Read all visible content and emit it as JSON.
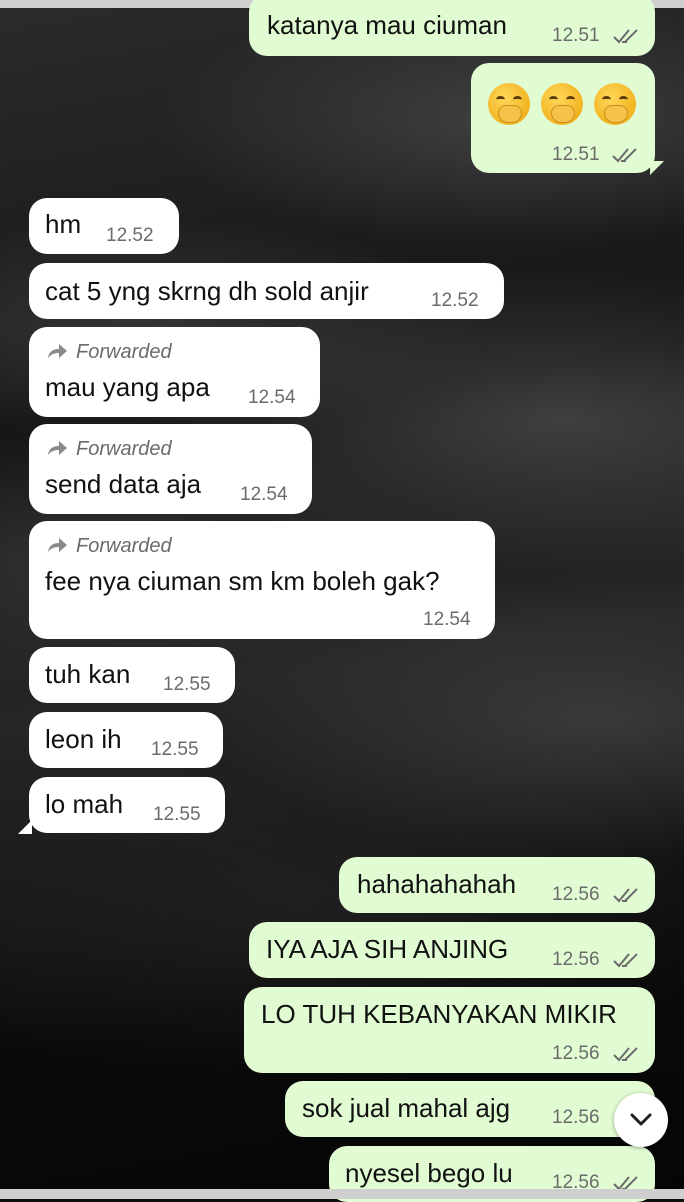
{
  "forwarded_label": "Forwarded",
  "messages": [
    {
      "dir": "out",
      "text": "katanya mau ciuman",
      "time": "12.51",
      "ticks": "read"
    },
    {
      "dir": "out",
      "text": "",
      "emoji": [
        "face-with-hand-over-mouth",
        "face-with-hand-over-mouth",
        "face-with-hand-over-mouth"
      ],
      "time": "12.51",
      "ticks": "read"
    },
    {
      "dir": "in",
      "text": "hm",
      "time": "12.52"
    },
    {
      "dir": "in",
      "text": "cat 5 yng skrng dh sold anjir",
      "time": "12.52"
    },
    {
      "dir": "in",
      "text": "mau yang apa",
      "time": "12.54",
      "forwarded": true
    },
    {
      "dir": "in",
      "text": "send data aja",
      "time": "12.54",
      "forwarded": true
    },
    {
      "dir": "in",
      "text": "fee nya ciuman sm km boleh gak?",
      "time": "12.54",
      "forwarded": true
    },
    {
      "dir": "in",
      "text": "tuh kan",
      "time": "12.55"
    },
    {
      "dir": "in",
      "text": "leon ih",
      "time": "12.55"
    },
    {
      "dir": "in",
      "text": "lo mah",
      "time": "12.55"
    },
    {
      "dir": "out",
      "text": "hahahahahah",
      "time": "12.56",
      "ticks": "read"
    },
    {
      "dir": "out",
      "text": "IYA AJA SIH ANJING",
      "time": "12.56",
      "ticks": "read"
    },
    {
      "dir": "out",
      "text": "LO TUH KEBANYAKAN MIKIR",
      "time": "12.56",
      "ticks": "read"
    },
    {
      "dir": "out",
      "text": "sok jual mahal ajg",
      "time": "12.56",
      "ticks": "read"
    },
    {
      "dir": "out",
      "text": "nyesel bego lu",
      "time": "12.56",
      "ticks": "read"
    }
  ],
  "scroll_button_icon": "chevron-down-icon",
  "colors": {
    "incoming": "#ffffff",
    "outgoing": "#e1fbd2",
    "timestamp": "#6b6b6b"
  }
}
